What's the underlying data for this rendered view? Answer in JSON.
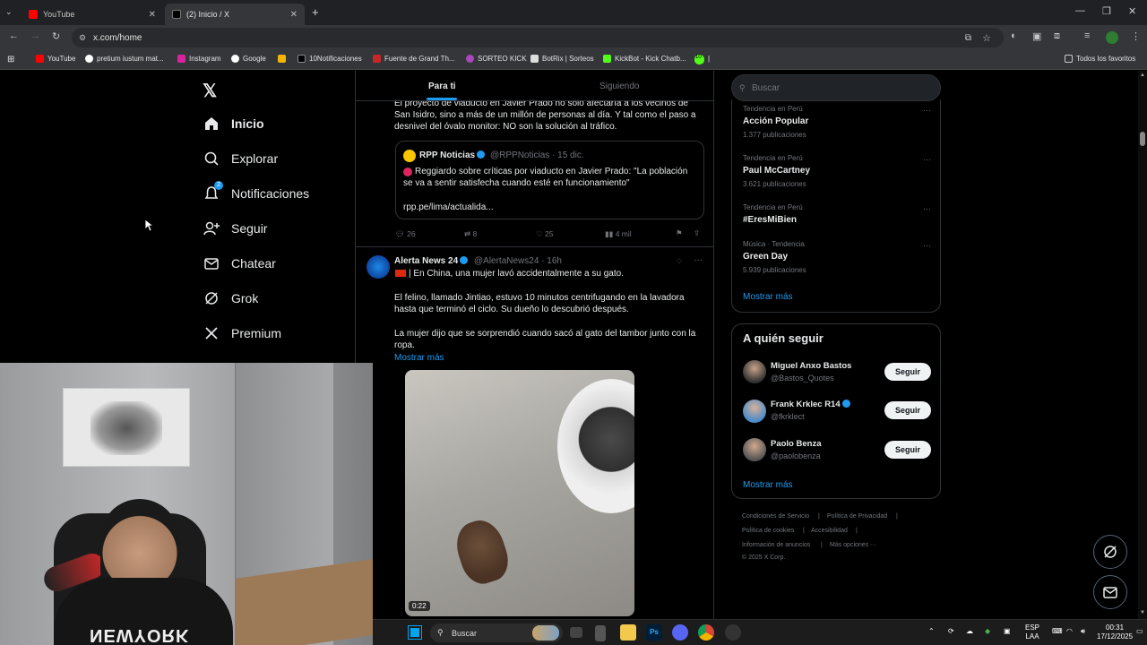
{
  "browser": {
    "tabs": [
      {
        "title": "YouTube",
        "active": false
      },
      {
        "title": "(2) Inicio / X",
        "active": true
      }
    ],
    "new_tab": "+",
    "url": "x.com/home",
    "bookmarks": [
      "YouTube",
      "pretium iustum mat...",
      "Instagram",
      "Google",
      "10Notificaciones",
      "Fuente de Grand Th...",
      "SORTEO KICK",
      "BotRix | Sorteos",
      "KickBot - Kick Chatb..."
    ],
    "bookmark_badge": "10",
    "all_bookmarks": "Todos los favoritos"
  },
  "nav": {
    "items": [
      {
        "label": "Inicio",
        "icon": "home-icon"
      },
      {
        "label": "Explorar",
        "icon": "search-icon"
      },
      {
        "label": "Notificaciones",
        "icon": "bell-icon",
        "badge": "2"
      },
      {
        "label": "Seguir",
        "icon": "add-user-icon"
      },
      {
        "label": "Chatear",
        "icon": "mail-icon"
      },
      {
        "label": "Grok",
        "icon": "grok-icon"
      },
      {
        "label": "Premium",
        "icon": "x-icon"
      }
    ]
  },
  "feed": {
    "tabs": [
      "Para ti",
      "Siguiendo"
    ],
    "post1": {
      "text_partial": "El proyecto de viaducto en Javier Prado no sólo afectaría a los vecinos de",
      "text": "San Isidro, sino a más de un millón de personas al día. Y tal como el paso a desnivel del óvalo monitor: NO son la solución al tráfico.",
      "quote": {
        "name": "RPP Noticias",
        "handle": "@RPPNoticias",
        "time": "· 15 dic.",
        "text": "Reggiardo sobre críticas por viaducto en Javier Prado: \"La población se va a sentir satisfecha cuando esté en funcionamiento\"",
        "link": "rpp.pe/lima/actualida..."
      },
      "stats": {
        "replies": "26",
        "reposts": "8",
        "likes": "25",
        "views": "4 mil"
      }
    },
    "post2": {
      "name": "Alerta News 24",
      "handle": "@AlertaNews24",
      "time": "· 16h",
      "line1": "| En China, una mujer lavó accidentalmente a su gato.",
      "para2": "El felino, llamado Jintiao, estuvo 10 minutos centrifugando en la lavadora hasta que terminó el ciclo. Su dueño lo descubrió después.",
      "para3": "La mujer dijo que se sorprendió cuando sacó al gato del tambor junto con la ropa.",
      "show_more": "Mostrar más",
      "video_time": "0:22"
    }
  },
  "sidebar": {
    "search_placeholder": "Buscar",
    "trends": [
      {
        "context": "Tendencia en Perú",
        "name": "Acción Popular",
        "count": "1.377 publicaciones"
      },
      {
        "context": "Tendencia en Perú",
        "name": "Paul McCartney",
        "count": "3.621 publicaciones"
      },
      {
        "context": "Tendencia en Perú",
        "name": "#EresMiBien",
        "count": ""
      },
      {
        "context": "Música · Tendencia",
        "name": "Green Day",
        "count": "5.939 publicaciones"
      }
    ],
    "trends_more": "Mostrar más",
    "who_to_follow_title": "A quién seguir",
    "follow": [
      {
        "name": "Miguel Anxo Bastos",
        "handle": "@Bastos_Quotes",
        "verified": false
      },
      {
        "name": "Frank Krklec R14",
        "handle": "@fkrklect",
        "verified": true
      },
      {
        "name": "Paolo Benza",
        "handle": "@paolobenza",
        "verified": false
      }
    ],
    "follow_button": "Seguir",
    "follow_more": "Mostrar más",
    "footer": {
      "terms": "Condiciones de Servicio",
      "privacy": "Política de Privacidad",
      "cookies": "Política de cookies",
      "accessibility": "Accesibilidad",
      "ads": "Información de anuncios",
      "more": "Más opciones ···",
      "copyright": "© 2025 X Corp."
    }
  },
  "webcam": {
    "shirt_text": "NEWYORK"
  },
  "taskbar": {
    "search_label": "Buscar",
    "lang": "ESP",
    "lang_sub": "LAA",
    "time": "00:31",
    "date": "17/12/2025"
  },
  "colors": {
    "accent": "#1d9bf0",
    "background": "#000000",
    "text": "#e7e9ea",
    "muted": "#71767b",
    "border": "#2f3336"
  }
}
